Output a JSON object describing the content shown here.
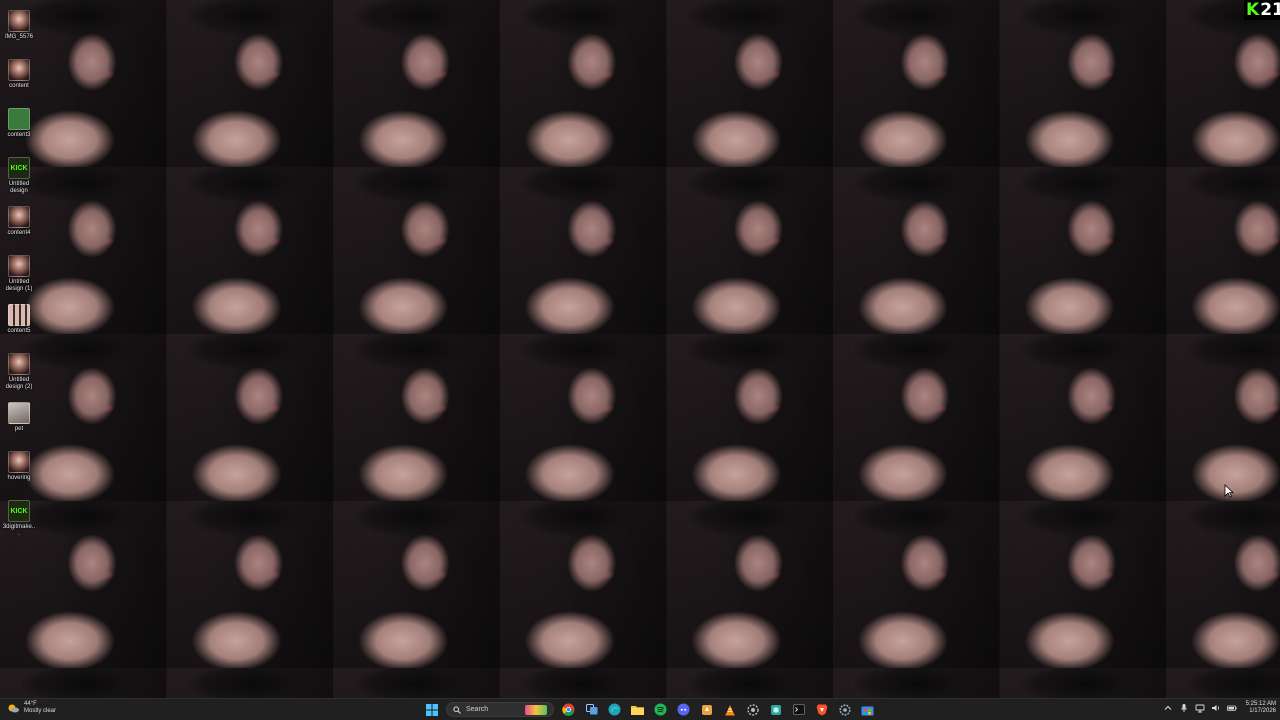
{
  "overlay": {
    "kick_letter": "K",
    "count": "21"
  },
  "desktop": {
    "icons": [
      {
        "label": "IMG_5576",
        "icon": "image-icon"
      },
      {
        "label": "content",
        "icon": "image-icon"
      },
      {
        "label": "content3",
        "icon": "image-icon"
      },
      {
        "label": "Untitled design",
        "icon": "kick-icon"
      },
      {
        "label": "content4",
        "icon": "image-icon"
      },
      {
        "label": "Untitled design (1)",
        "icon": "image-icon"
      },
      {
        "label": "content5",
        "icon": "image-icon"
      },
      {
        "label": "Untitled design (2)",
        "icon": "image-icon"
      },
      {
        "label": "pet",
        "icon": "image-icon"
      },
      {
        "label": "hovering",
        "icon": "image-icon"
      },
      {
        "label": "3digitmake...",
        "icon": "kick-icon"
      }
    ]
  },
  "taskbar": {
    "weather": {
      "temp": "44°F",
      "condition": "Mostly clear"
    },
    "search_placeholder": "Search",
    "apps": [
      "start-icon",
      "search",
      "widgets-icon",
      "chrome-icon",
      "task-view-icon",
      "edge-icon",
      "file-explorer-icon",
      "spotify-icon",
      "discord-icon",
      "app-icon",
      "vlc-icon",
      "settings-app-icon",
      "app-icon",
      "terminal-icon",
      "brave-icon",
      "settings-icon",
      "store-icon"
    ],
    "clock": {
      "time": "5:25:12 AM",
      "date": "1/17/2026"
    }
  },
  "colors": {
    "kick_green": "#53fc18",
    "taskbar_bg": "#202020"
  }
}
